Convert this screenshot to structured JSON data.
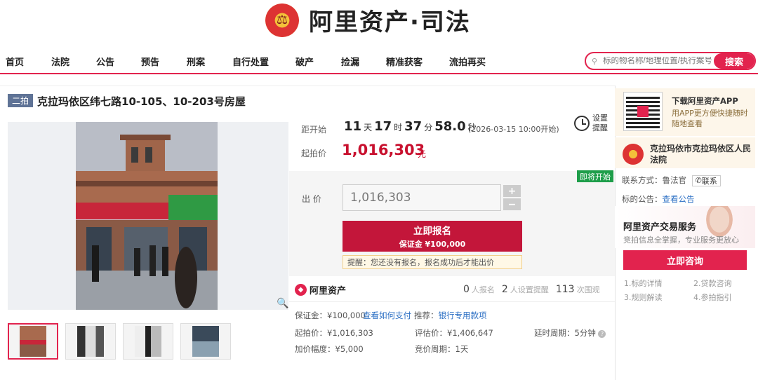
{
  "brand": {
    "title": "阿里资产·司法",
    "emblem_glyph": "⚖"
  },
  "nav": {
    "items": [
      "首页",
      "法院",
      "公告",
      "预告",
      "刑案",
      "自行处置",
      "破产",
      "捡漏",
      "精准获客",
      "流拍再买"
    ]
  },
  "search": {
    "placeholder": "标的物名称/地理位置/执行案号",
    "button": "搜索"
  },
  "lot": {
    "badge": "二拍",
    "title": "克拉玛依区纬七路10-105、10-203号房屋"
  },
  "countdown": {
    "label": "距开始",
    "days": "11",
    "d_unit": "天",
    "hours": "17",
    "h_unit": "时",
    "minutes": "37",
    "m_unit": "分",
    "seconds": "58.0",
    "s_unit": "秒",
    "start": "(2026-03-15 10:00开始)"
  },
  "remind": {
    "label": "设置提醒"
  },
  "price": {
    "label": "起拍价",
    "value": "1,016,303",
    "unit": "元"
  },
  "bid": {
    "soon_badge": "即将开始",
    "label": "出 价",
    "value": "1,016,303",
    "plus": "+",
    "minus": "−",
    "signup": "立即报名",
    "deposit": "保证金 ¥100,000",
    "tip": "提醒：您还没有报名，报名成功后才能出价"
  },
  "stats": {
    "brand": "阿里资产",
    "signups": "0",
    "signups_label": "人报名",
    "reminders": "2",
    "reminders_label": "人设置提醒",
    "views": "113",
    "views_label": "次围观"
  },
  "details": {
    "deposit_label": "保证金：",
    "deposit": "¥100,000",
    "how_pay": "查看如何支付",
    "recommend_label": "推荐：",
    "recommend": "银行专用款项",
    "start_price_label": "起拍价：",
    "start_price": "¥1,016,303",
    "eval_label": "评估价：",
    "eval": "¥1,406,647",
    "delay_label": "延时周期：",
    "delay": "5分钟",
    "increment_label": "加价幅度：",
    "increment": "¥5,000",
    "cycle_label": "竞价周期：",
    "cycle": "1天",
    "help": "?"
  },
  "side": {
    "app_title": "下载阿里资产APP",
    "app_sub": "用APP更方便快捷随时随地查看",
    "court": "克拉玛依市克拉玛依区人民法院",
    "contact_label": "联系方式：",
    "contact_name": "鲁法官",
    "contact_btn": "联系",
    "notice_label": "标的公告：",
    "notice_link": "查看公告",
    "svc_title": "阿里资产交易服务",
    "svc_sub": "竞拍信息全掌握，专业服务更放心",
    "consult": "立即咨询",
    "guides": [
      "1.标的详情",
      "2.贷款咨询",
      "3.规则解读",
      "4.参拍指引"
    ]
  },
  "photo": {
    "zoom_icon": "🔍"
  }
}
